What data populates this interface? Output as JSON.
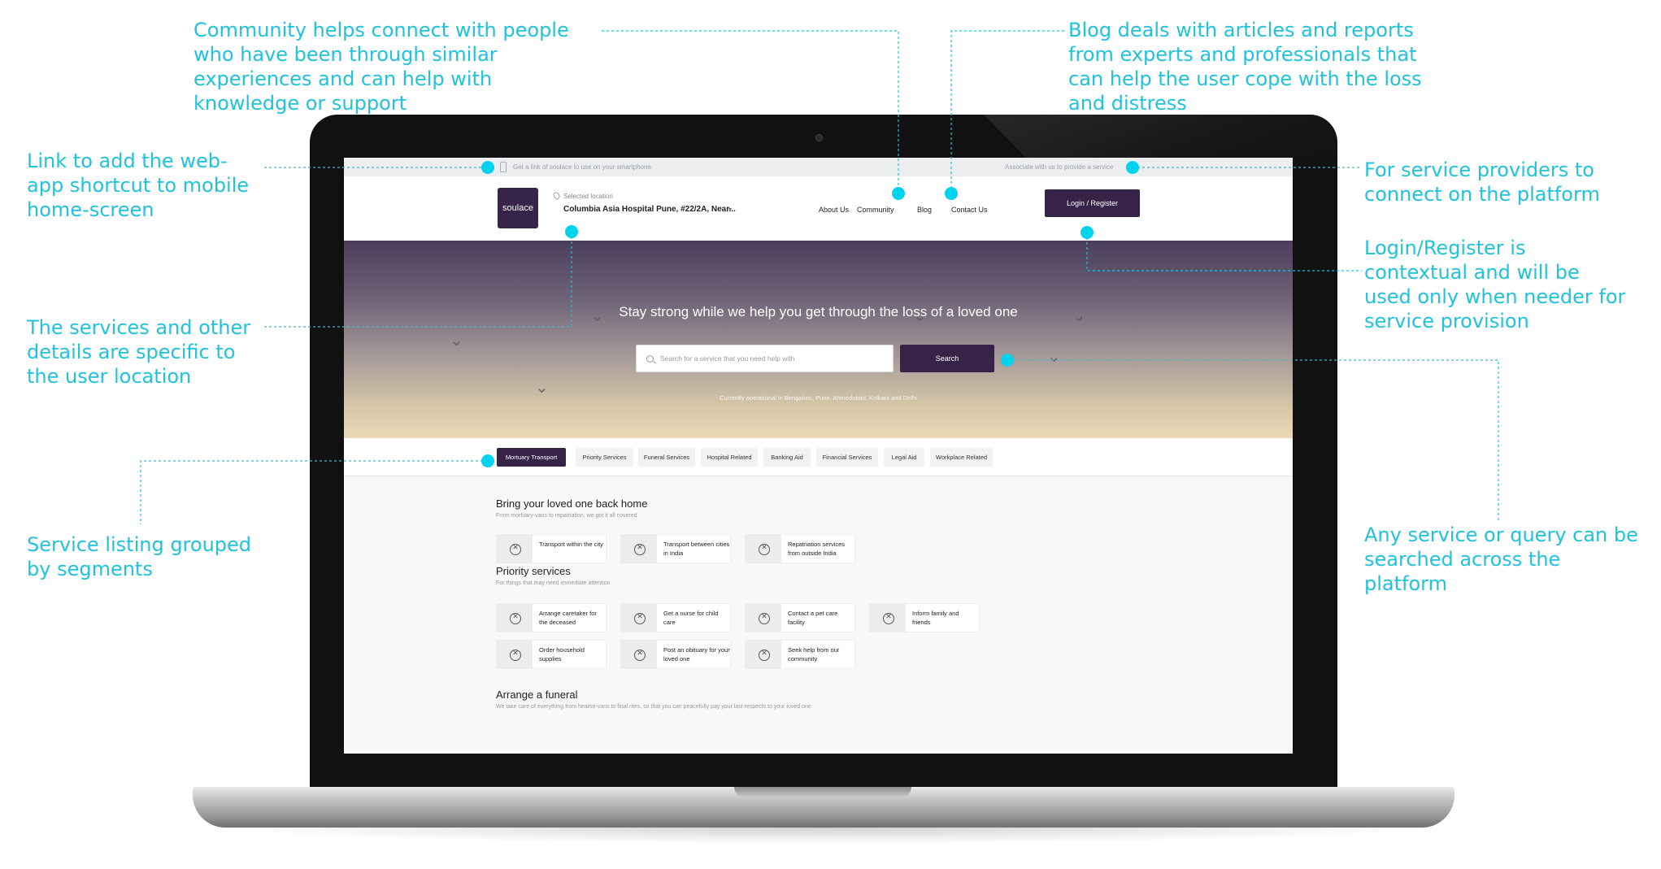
{
  "annotations": {
    "community": "Community helps connect with people who have been through similar experiences and can help with knowledge or support",
    "blog": "Blog deals with articles and reports from experts and professionals that can help the user cope with the loss and distress",
    "webapp": "Link to add the web-app shortcut to mobile home-screen",
    "providers": "For service providers to connect on the platform",
    "login": "Login/Register is contextual and will be used only when needer for service provision",
    "location": "The services and other details are specific to the user location",
    "search": "Any service or query can be searched across the platform",
    "listing": "Service listing grouped by segments"
  },
  "topbar": {
    "left_text": "Get a link of soulace to use on your smartphone",
    "right_text": "Associate with us to provide a service"
  },
  "navbar": {
    "logo_text": "soulace",
    "location_label": "Selected location",
    "location_value": "Columbia Asia Hospital Pune, #22/2A, Near...",
    "links": [
      "About Us",
      "Community",
      "Blog",
      "Contact Us"
    ],
    "login_label": "Login / Register"
  },
  "hero": {
    "title": "Stay strong while we help you get through the loss of a loved one",
    "search_placeholder": "Search for a service that you need help with",
    "search_button": "Search",
    "footer": "Currently operational in Bengaluru, Pune, Ahmedabad, Kolkata and Delhi"
  },
  "tabs": [
    "Mortuary Transport",
    "Priority Services",
    "Funeral Services",
    "Hospital Related",
    "Banking Aid",
    "Financial Services",
    "Legal Aid",
    "Workplace Related"
  ],
  "sections": [
    {
      "title": "Bring your loved one back home",
      "subtitle": "From mortuary-vans to repatriation, we got it all covered",
      "cards": [
        "Transport within the city",
        "Transport between cities in India",
        "Repatriation services from outside India"
      ]
    },
    {
      "title": "Priority services",
      "subtitle": "For things that may need immediate attention",
      "cards": [
        "Arrange caretaker for the deceased",
        "Get a nurse for child care",
        "Contact a pet care facility",
        "Inform family and friends",
        "Order household supplies",
        "Post an obituary for your loved one",
        "Seek help from our community"
      ]
    },
    {
      "title": "Arrange a funeral",
      "subtitle": "We take care of everything from hearse-vans to final rites, so that you can peacefully pay your last respects to your loved one"
    }
  ],
  "colors": {
    "annotation": "#21c2dc",
    "dot": "#00d3ee",
    "brand": "#362347"
  }
}
